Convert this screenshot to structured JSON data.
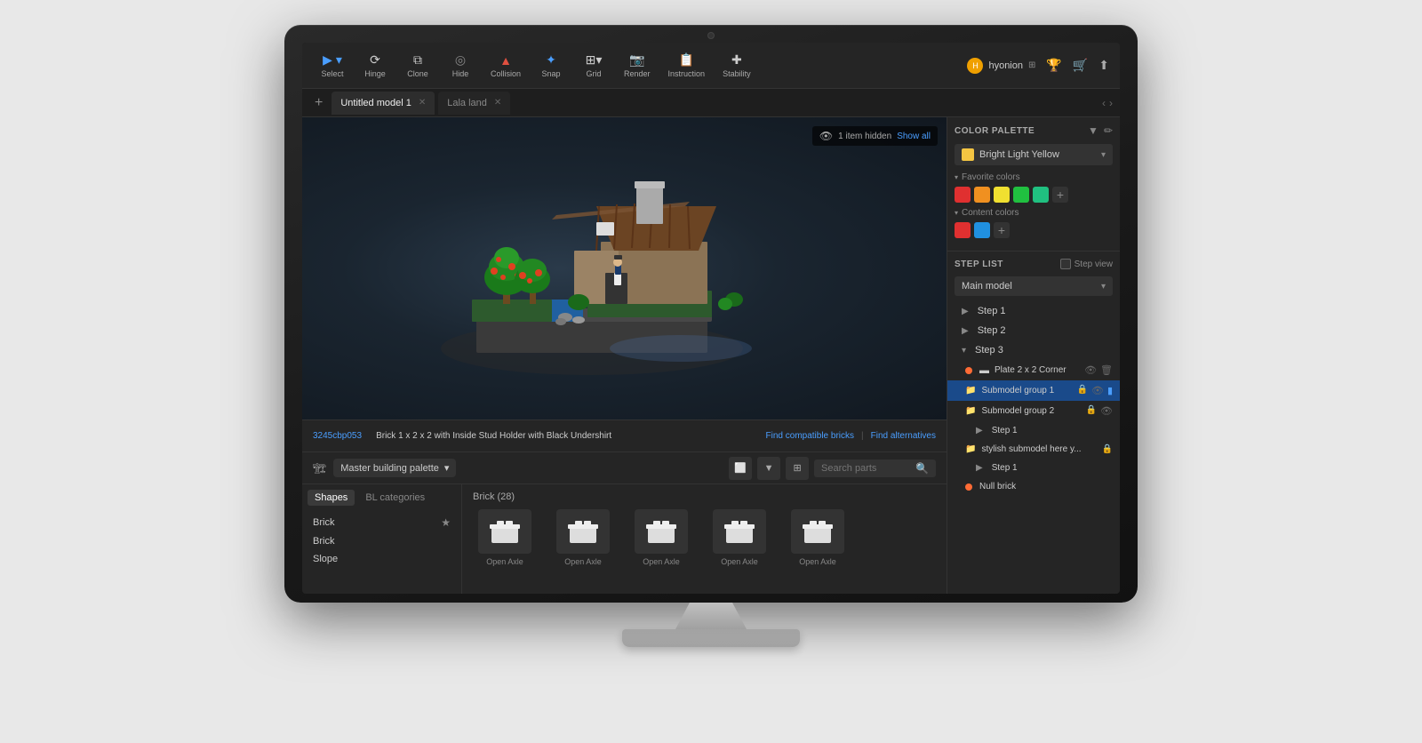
{
  "toolbar": {
    "items": [
      {
        "id": "select",
        "icon": "▶",
        "label": "Select"
      },
      {
        "id": "hinge",
        "icon": "⟳",
        "label": "Hinge"
      },
      {
        "id": "clone",
        "icon": "⧉",
        "label": "Clone"
      },
      {
        "id": "hide",
        "icon": "◎",
        "label": "Hide"
      },
      {
        "id": "collision",
        "icon": "▲",
        "label": "Collision"
      },
      {
        "id": "snap",
        "icon": "✦",
        "label": "Snap"
      },
      {
        "id": "grid",
        "icon": "⊞",
        "label": "Grid"
      },
      {
        "id": "render",
        "icon": "⬛",
        "label": "Render"
      },
      {
        "id": "instruction",
        "icon": "⬛",
        "label": "Instruction"
      },
      {
        "id": "stability",
        "icon": "✚",
        "label": "Stability"
      }
    ],
    "user": {
      "name": "hyonion",
      "avatar_color": "#f0a000"
    }
  },
  "tabs": [
    {
      "id": "tab1",
      "label": "Untitled model 1",
      "active": true
    },
    {
      "id": "tab2",
      "label": "Lala land",
      "active": false
    }
  ],
  "viewport": {
    "hidden_badge": "1 item hidden",
    "show_all": "Show all"
  },
  "info_bar": {
    "brick_id": "3245cbp053",
    "brick_name": "Brick 1 x 2 x 2 with Inside Stud Holder with Black Undershirt",
    "find_compatible": "Find compatible bricks",
    "find_alternatives": "Find alternatives"
  },
  "parts_panel": {
    "palette_label": "Master building palette",
    "search_placeholder": "Search parts",
    "tabs": [
      {
        "id": "shapes",
        "label": "Shapes",
        "active": true
      },
      {
        "id": "bl_categories",
        "label": "BL categories",
        "active": false
      }
    ],
    "shapes": [
      {
        "name": "Brick",
        "starred": true
      },
      {
        "name": "Brick",
        "starred": false
      },
      {
        "name": "Slope",
        "starred": false
      }
    ],
    "section_title": "Brick (28)",
    "parts": [
      {
        "label": "Open Axle"
      },
      {
        "label": "Open Axle"
      },
      {
        "label": "Open Axle"
      },
      {
        "label": "Open Axle"
      },
      {
        "label": "Open Axle"
      }
    ]
  },
  "color_palette": {
    "section_title": "COLOR PALETTE",
    "selected_color": {
      "name": "Bright Light Yellow",
      "hex": "#f4c542"
    },
    "favorite_colors": {
      "title": "Favorite colors",
      "colors": [
        "#e03030",
        "#f09020",
        "#f0e030",
        "#20c040",
        "#20c080"
      ]
    },
    "content_colors": {
      "title": "Content colors",
      "colors": [
        "#e03030",
        "#2090e0"
      ]
    }
  },
  "step_list": {
    "section_title": "STEP LIST",
    "step_view_label": "Step view",
    "model_selector": "Main model",
    "steps": [
      {
        "level": 1,
        "label": "Step 1",
        "expandable": true,
        "type": "step"
      },
      {
        "level": 1,
        "label": "Step 2",
        "expandable": true,
        "type": "step"
      },
      {
        "level": 1,
        "label": "Step 3",
        "expandable": false,
        "type": "step",
        "expanded": true
      },
      {
        "level": 2,
        "label": "Plate 2 x 2 Corner",
        "type": "brick",
        "warn": true
      },
      {
        "level": 2,
        "label": "Submodel group 1",
        "type": "submodel",
        "active": true,
        "locked": true
      },
      {
        "level": 2,
        "label": "Submodel group 2",
        "type": "submodel",
        "locked": true
      },
      {
        "level": 3,
        "label": "Step 1",
        "type": "step",
        "expandable": true
      },
      {
        "level": 2,
        "label": "stylish submodel here y...",
        "type": "submodel",
        "locked": true
      },
      {
        "level": 3,
        "label": "Step 1",
        "type": "step",
        "expandable": true
      },
      {
        "level": 2,
        "label": "Null brick",
        "type": "brick",
        "warn": true
      }
    ]
  }
}
